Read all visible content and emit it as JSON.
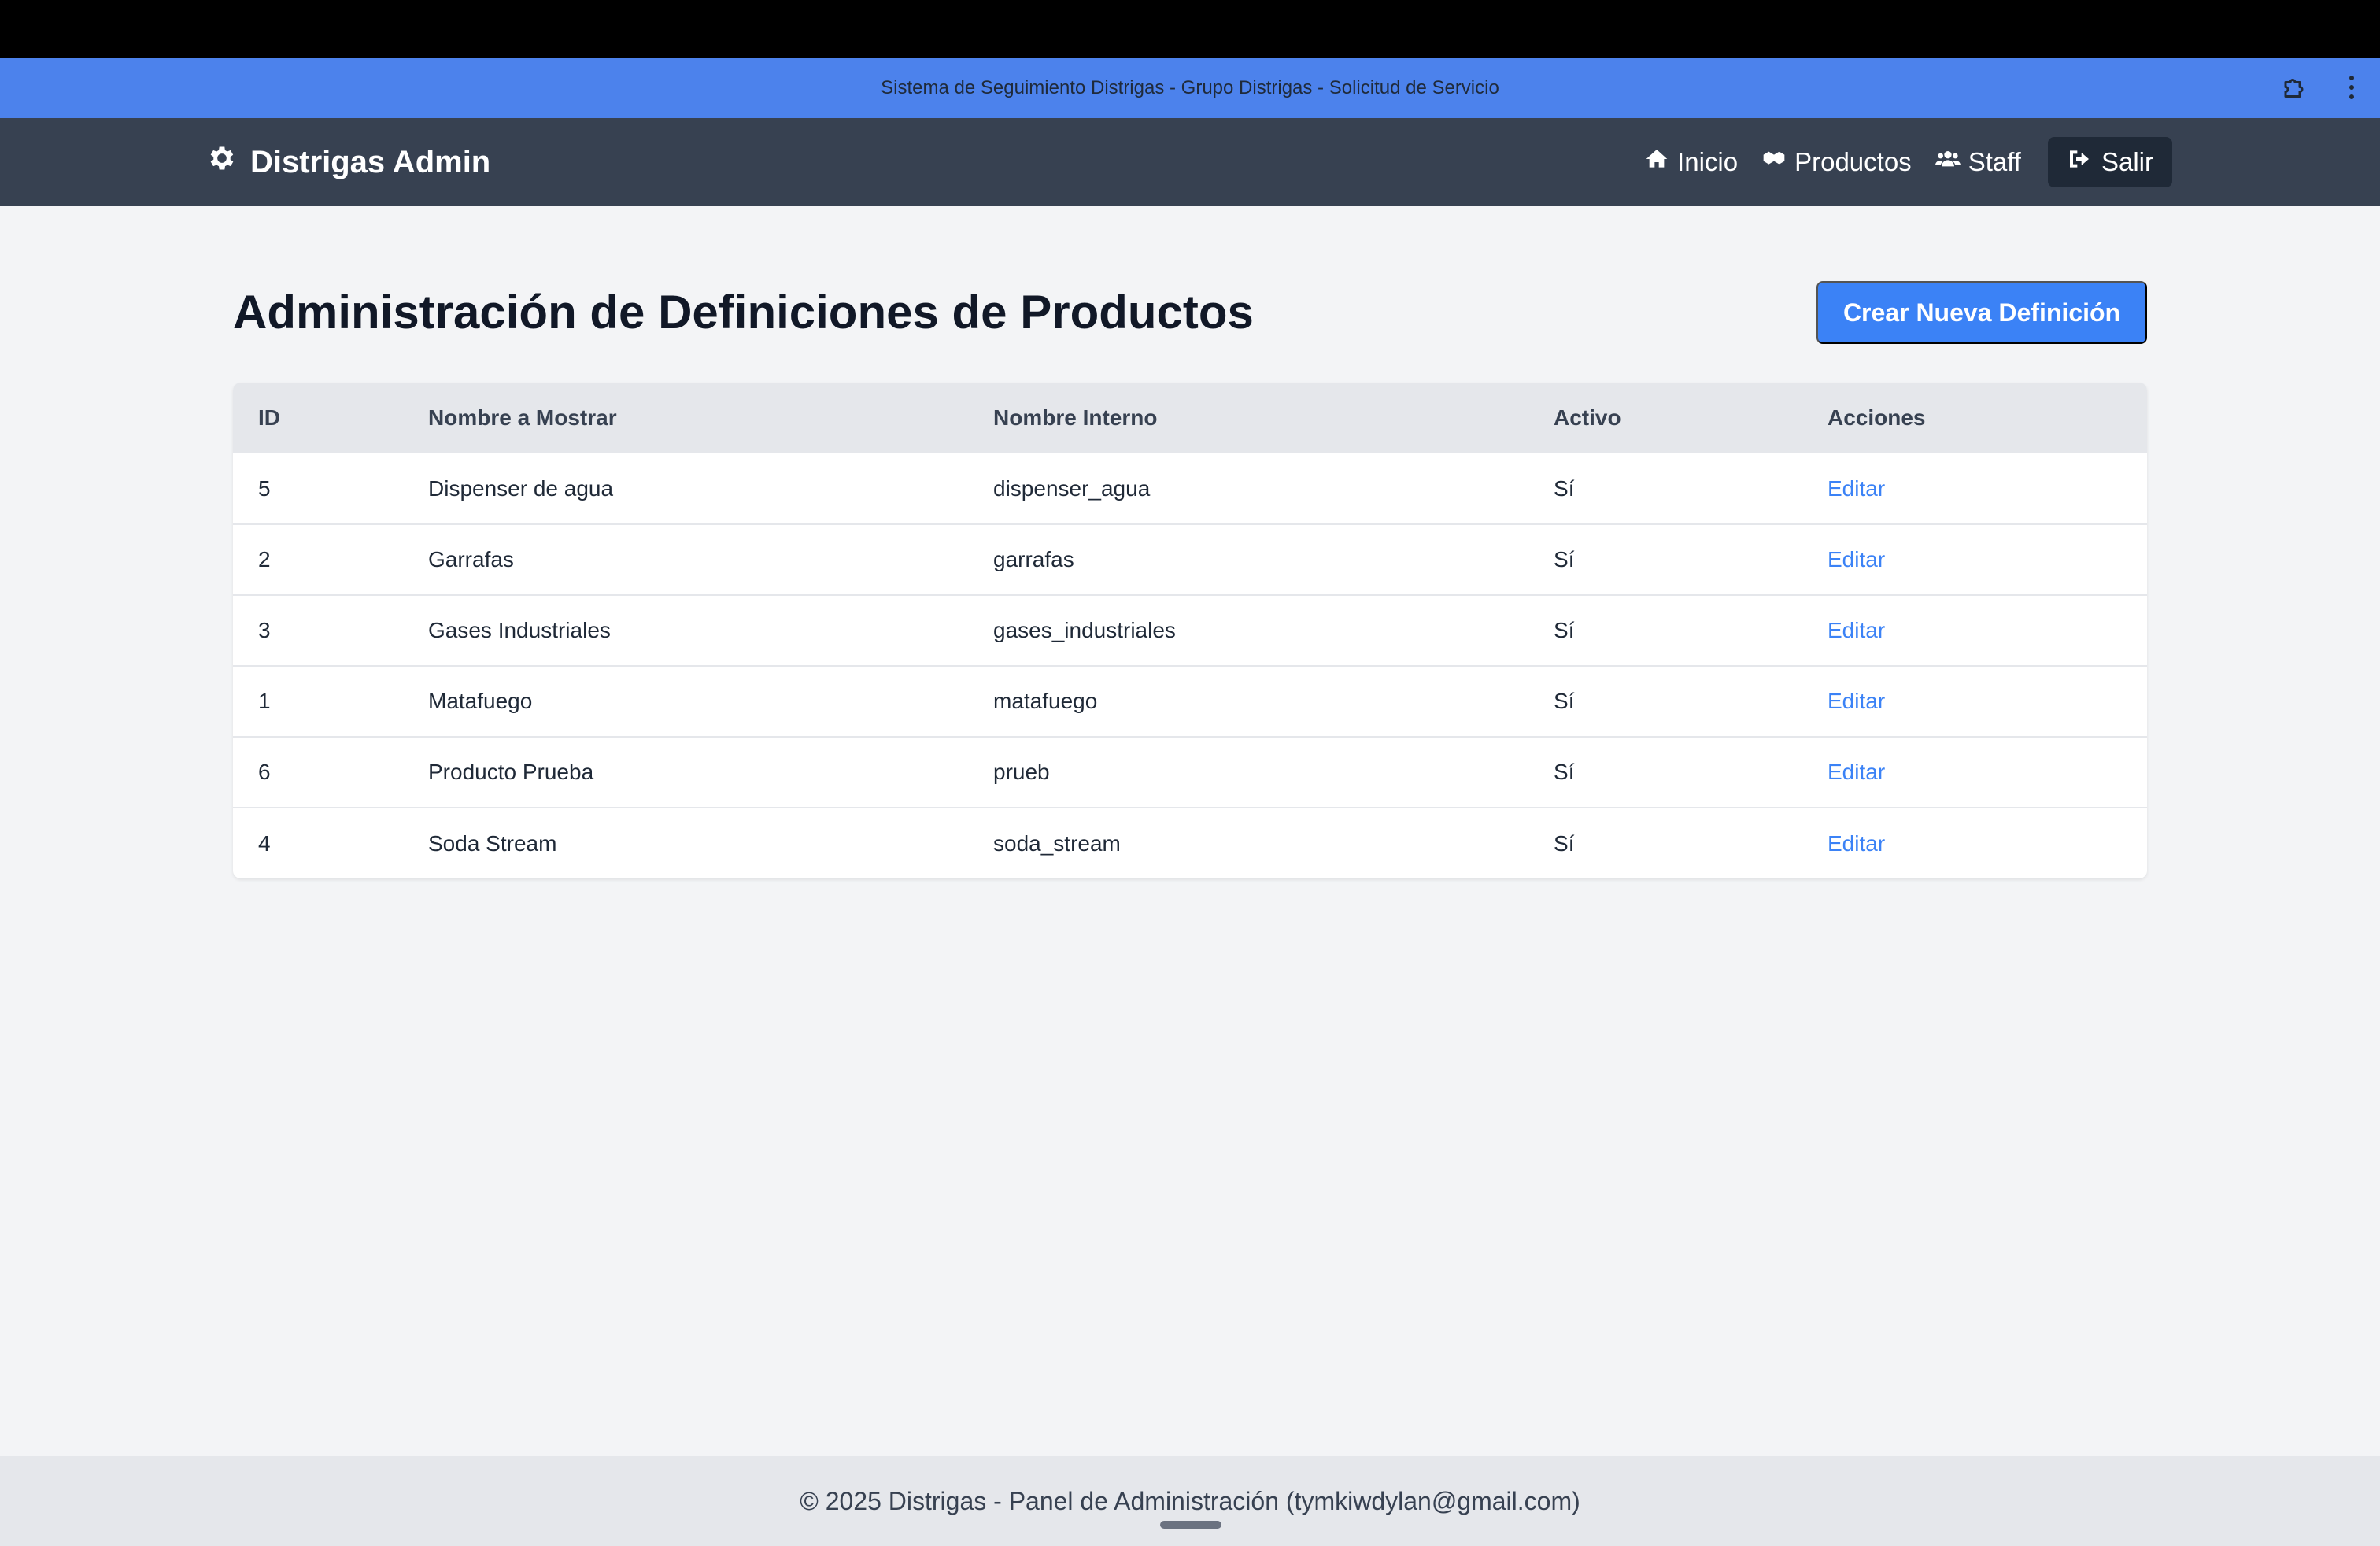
{
  "browser": {
    "title": "Sistema de Seguimiento Distrigas - Grupo Distrigas - Solicitud de Servicio",
    "extensions_icon": "puzzle-icon",
    "menu_icon": "more-vertical-icon"
  },
  "navbar": {
    "brand": "Distrigas Admin",
    "brand_icon": "gear-icon",
    "links": [
      {
        "label": "Inicio",
        "icon": "home-icon"
      },
      {
        "label": "Productos",
        "icon": "boxes-icon"
      },
      {
        "label": "Staff",
        "icon": "users-icon"
      }
    ],
    "logout": {
      "label": "Salir",
      "icon": "sign-out-icon"
    }
  },
  "page": {
    "title": "Administración de Definiciones de Productos",
    "create_button": "Crear Nueva Definición"
  },
  "table": {
    "headers": [
      "ID",
      "Nombre a Mostrar",
      "Nombre Interno",
      "Activo",
      "Acciones"
    ],
    "rows": [
      {
        "id": "5",
        "display_name": "Dispenser de agua",
        "internal_name": "dispenser_agua",
        "active": "Sí",
        "action": "Editar"
      },
      {
        "id": "2",
        "display_name": "Garrafas",
        "internal_name": "garrafas",
        "active": "Sí",
        "action": "Editar"
      },
      {
        "id": "3",
        "display_name": "Gases Industriales",
        "internal_name": "gases_industriales",
        "active": "Sí",
        "action": "Editar"
      },
      {
        "id": "1",
        "display_name": "Matafuego",
        "internal_name": "matafuego",
        "active": "Sí",
        "action": "Editar"
      },
      {
        "id": "6",
        "display_name": "Producto Prueba",
        "internal_name": "prueb",
        "active": "Sí",
        "action": "Editar"
      },
      {
        "id": "4",
        "display_name": "Soda Stream",
        "internal_name": "soda_stream",
        "active": "Sí",
        "action": "Editar"
      }
    ]
  },
  "footer": {
    "text": "© 2025 Distrigas - Panel de Administración (tymkiwdylan@gmail.com)"
  },
  "colors": {
    "appbar": "#4c82ec",
    "navbar": "#374151",
    "primary": "#3b82f6",
    "background": "#f3f4f6"
  }
}
